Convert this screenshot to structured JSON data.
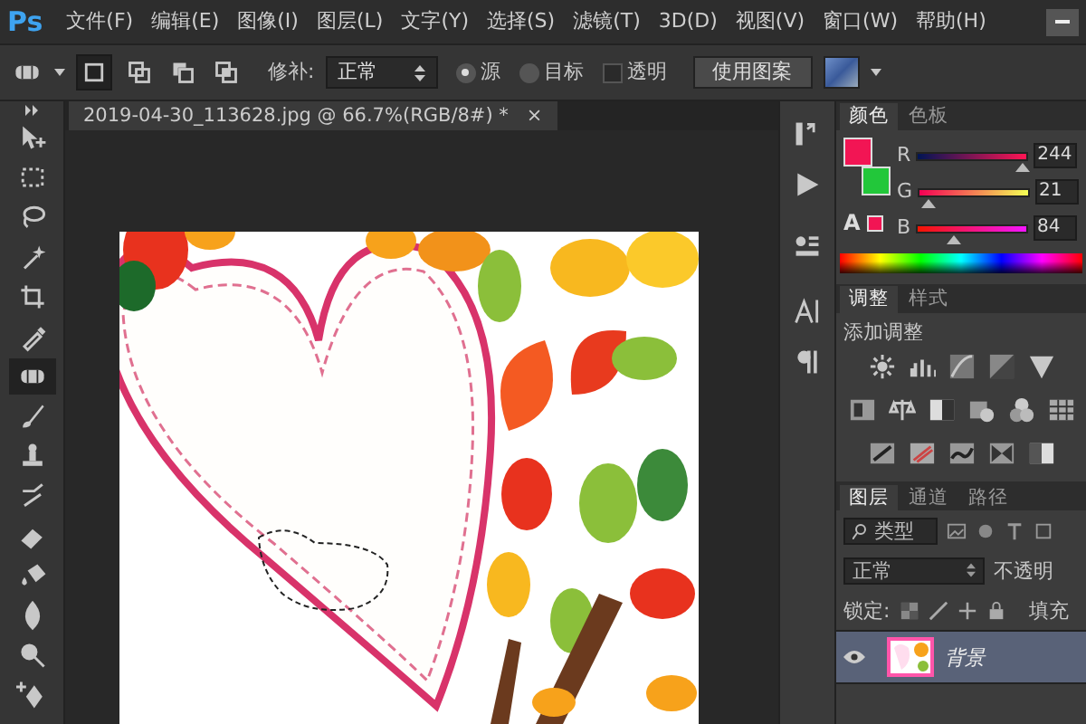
{
  "app": {
    "logo": "Ps"
  },
  "menu": [
    "文件(F)",
    "编辑(E)",
    "图像(I)",
    "图层(L)",
    "文字(Y)",
    "选择(S)",
    "滤镜(T)",
    "3D(D)",
    "视图(V)",
    "窗口(W)",
    "帮助(H)"
  ],
  "options_bar": {
    "modes": [
      {
        "selected": true
      },
      {
        "selected": false
      },
      {
        "selected": false
      },
      {
        "selected": false
      }
    ],
    "patch_label": "修补:",
    "patch_mode": "正常",
    "radios": [
      {
        "label": "源",
        "selected": true
      },
      {
        "label": "目标",
        "selected": false
      }
    ],
    "transparent": {
      "label": "透明",
      "checked": false
    },
    "use_pattern_button": "使用图案"
  },
  "document_tab": {
    "title": "2019-04-30_113628.jpg @ 66.7%(RGB/8#) *",
    "close": "×"
  },
  "tools": [
    {
      "kind": "move",
      "selected": false
    },
    {
      "kind": "marquee",
      "selected": false
    },
    {
      "kind": "lasso",
      "selected": false
    },
    {
      "kind": "wand",
      "selected": false
    },
    {
      "kind": "crop",
      "selected": false
    },
    {
      "kind": "eyedropper",
      "selected": false
    },
    {
      "kind": "healing",
      "selected": true
    },
    {
      "kind": "brush",
      "selected": false
    },
    {
      "kind": "stamp",
      "selected": false
    },
    {
      "kind": "history",
      "selected": false
    },
    {
      "kind": "eraser",
      "selected": false
    },
    {
      "kind": "bucket",
      "selected": false
    },
    {
      "kind": "blur",
      "selected": false
    },
    {
      "kind": "dodge",
      "selected": false
    },
    {
      "kind": "pen",
      "selected": false
    }
  ],
  "color_panel": {
    "tabs": [
      {
        "label": "颜色",
        "selected": true
      },
      {
        "label": "色板",
        "selected": false
      }
    ],
    "swatches": [
      {
        "kind": "foreground",
        "color": "#f21554"
      },
      {
        "kind": "background",
        "color": "#22c73a"
      }
    ],
    "gamut_warning": "A",
    "channels": [
      {
        "name": "R",
        "level": 0.957,
        "value": "244"
      },
      {
        "name": "G",
        "level": 0.082,
        "value": "21"
      },
      {
        "name": "B",
        "level": 0.329,
        "value": "84"
      }
    ]
  },
  "adjustments_panel": {
    "tabs": [
      {
        "label": "调整",
        "selected": true
      },
      {
        "label": "样式",
        "selected": false
      }
    ],
    "heading": "添加调整"
  },
  "layers_panel": {
    "tabs": [
      {
        "label": "图层",
        "selected": true
      },
      {
        "label": "通道",
        "selected": false
      },
      {
        "label": "路径",
        "selected": false
      }
    ],
    "filter": "类型",
    "blend_mode": "正常",
    "opacity_label": "不透明",
    "lock_label": "锁定:",
    "fill_label": "填充",
    "layers": [
      {
        "name": "背景",
        "visible": true,
        "selected": true
      }
    ]
  }
}
